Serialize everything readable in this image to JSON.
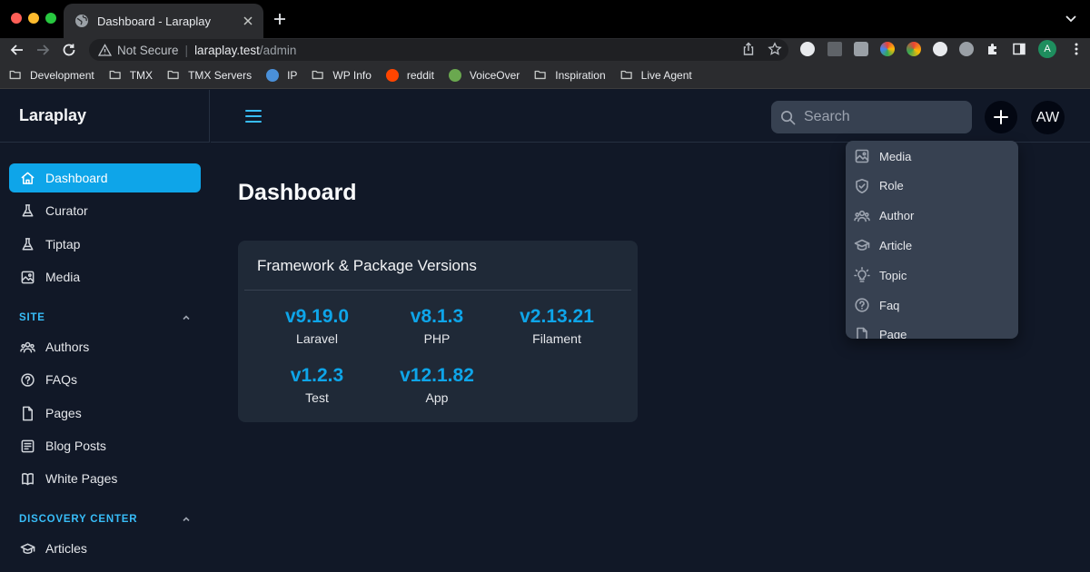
{
  "browser": {
    "tab_title": "Dashboard - Laraplay",
    "not_secure": "Not Secure",
    "url_host": "laraplay.test",
    "url_path": "/admin",
    "profile_initial": "A",
    "bookmarks": [
      {
        "label": "Development",
        "icon": "folder-icon"
      },
      {
        "label": "TMX",
        "icon": "folder-icon"
      },
      {
        "label": "TMX Servers",
        "icon": "folder-icon"
      },
      {
        "label": "IP",
        "icon": "ip-icon"
      },
      {
        "label": "WP Info",
        "icon": "folder-icon"
      },
      {
        "label": "reddit",
        "icon": "reddit-icon"
      },
      {
        "label": "VoiceOver",
        "icon": "voiceover-icon"
      },
      {
        "label": "Inspiration",
        "icon": "folder-icon"
      },
      {
        "label": "Live Agent",
        "icon": "folder-icon"
      }
    ]
  },
  "app": {
    "brand": "Laraplay",
    "search_placeholder": "Search",
    "avatar_initials": "AW",
    "accent": "#0ea5e9"
  },
  "sidebar": {
    "items": [
      {
        "label": "Dashboard",
        "icon": "home-icon",
        "active": true
      },
      {
        "label": "Curator",
        "icon": "flask-icon"
      },
      {
        "label": "Tiptap",
        "icon": "flask-icon"
      },
      {
        "label": "Media",
        "icon": "image-icon"
      }
    ],
    "groups": [
      {
        "label": "SITE",
        "items": [
          {
            "label": "Authors",
            "icon": "users-icon"
          },
          {
            "label": "FAQs",
            "icon": "question-icon"
          },
          {
            "label": "Pages",
            "icon": "document-icon"
          },
          {
            "label": "Blog Posts",
            "icon": "newspaper-icon"
          },
          {
            "label": "White Pages",
            "icon": "book-icon"
          }
        ]
      },
      {
        "label": "DISCOVERY CENTER",
        "items": [
          {
            "label": "Articles",
            "icon": "academic-cap-icon"
          }
        ]
      }
    ]
  },
  "main": {
    "title": "Dashboard",
    "card": {
      "heading": "Framework & Package Versions",
      "versions": [
        {
          "version": "v9.19.0",
          "name": "Laravel"
        },
        {
          "version": "v8.1.3",
          "name": "PHP"
        },
        {
          "version": "v2.13.21",
          "name": "Filament"
        },
        {
          "version": "v1.2.3",
          "name": "Test"
        },
        {
          "version": "v12.1.82",
          "name": "App"
        }
      ]
    }
  },
  "create_menu": {
    "items": [
      {
        "label": "Media",
        "icon": "image-icon"
      },
      {
        "label": "Role",
        "icon": "shield-icon"
      },
      {
        "label": "Author",
        "icon": "users-icon"
      },
      {
        "label": "Article",
        "icon": "academic-cap-icon"
      },
      {
        "label": "Topic",
        "icon": "lightbulb-icon"
      },
      {
        "label": "Faq",
        "icon": "question-icon"
      },
      {
        "label": "Page",
        "icon": "document-icon"
      }
    ]
  }
}
